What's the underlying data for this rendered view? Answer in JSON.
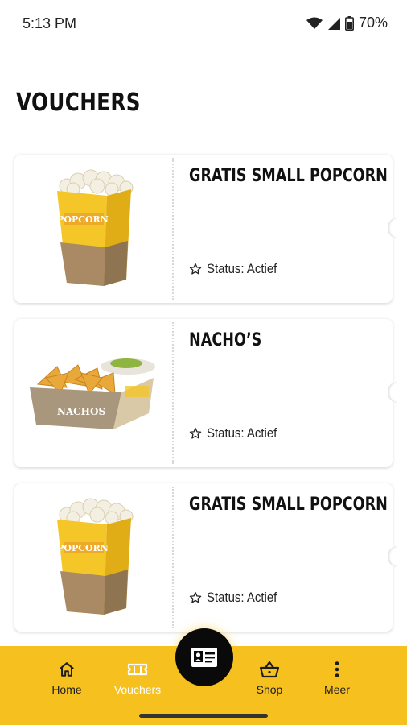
{
  "status_bar": {
    "time": "5:13 PM",
    "battery": "70%"
  },
  "page": {
    "title": "VOUCHERS"
  },
  "vouchers": [
    {
      "name": "GRATIS SMALL POPCORN",
      "status": "Status: Actief",
      "image": "popcorn-box"
    },
    {
      "name": "NACHO’S",
      "status": "Status: Actief",
      "image": "nachos-tray"
    },
    {
      "name": "GRATIS SMALL POPCORN",
      "status": "Status: Actief",
      "image": "popcorn-box"
    }
  ],
  "product_art": {
    "popcorn_brand": "POPCORN",
    "nacho_brand": "NACHOS"
  },
  "bottom_nav": {
    "items": [
      {
        "label": "Home",
        "icon": "home-icon"
      },
      {
        "label": "Vouchers",
        "icon": "ticket-icon",
        "active": true
      },
      {
        "label": "Shop",
        "icon": "basket-icon"
      },
      {
        "label": "Meer",
        "icon": "more-vertical-icon"
      }
    ],
    "center_button_icon": "member-card-icon"
  },
  "colors": {
    "accent": "#f6c11f",
    "active_nav": "#ffffff",
    "fab": "#0a0a0a"
  }
}
